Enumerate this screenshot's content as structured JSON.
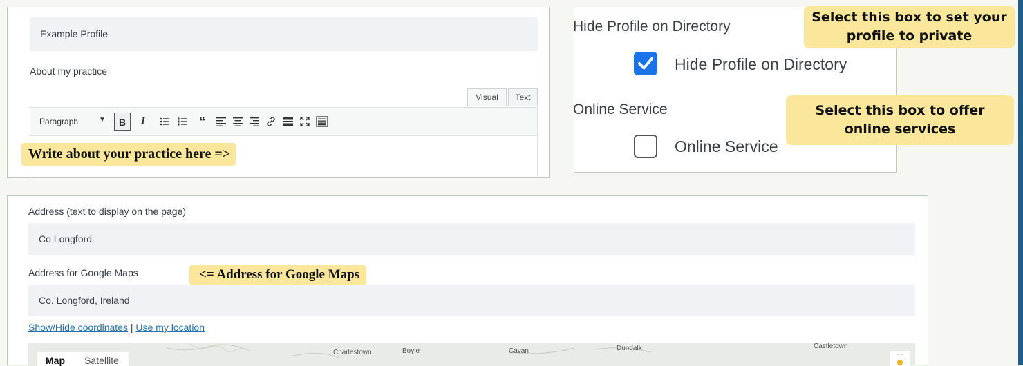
{
  "profile": {
    "name_value": "Example Profile",
    "about_label": "About my practice",
    "editor": {
      "tabs": [
        "Visual",
        "Text"
      ],
      "format_select": "Paragraph",
      "toolbar_icons": [
        "bold-icon",
        "italic-icon",
        "bullet-list-icon",
        "numbered-list-icon",
        "blockquote-icon",
        "align-left-icon",
        "align-center-icon",
        "align-right-icon",
        "link-icon",
        "read-more-icon",
        "fullscreen-icon",
        "toolbar-toggle-icon"
      ]
    },
    "callout": "Write about your practice here =>"
  },
  "options": {
    "hide_profile": {
      "heading": "Hide Profile on Directory",
      "label": "Hide Profile on Directory",
      "checked": true
    },
    "online_service": {
      "heading": "Online Service",
      "label": "Online Service",
      "checked": false
    },
    "callout_private": "Select this box to set your profile to private",
    "callout_online": "Select this box to offer online services"
  },
  "address": {
    "display_label": "Address (text to display on the page)",
    "display_value": "Co Longford",
    "maps_label": "Address for Google Maps",
    "maps_value": "Co. Longford, Ireland",
    "callout": "<= Address for Google Maps",
    "link_show_hide": "Show/Hide coordinates",
    "link_separator": "|",
    "link_location": "Use my location",
    "map": {
      "buttons": [
        "Map",
        "Satellite"
      ],
      "places": [
        "Charlestown",
        "Boyle",
        "Cavan",
        "Dundalk",
        "Castletown"
      ]
    }
  },
  "colors": {
    "callout": "#fbe79b",
    "checkbox": "#1a73e8",
    "link": "#2271b1",
    "accent_edge": "#1f5d8a"
  }
}
